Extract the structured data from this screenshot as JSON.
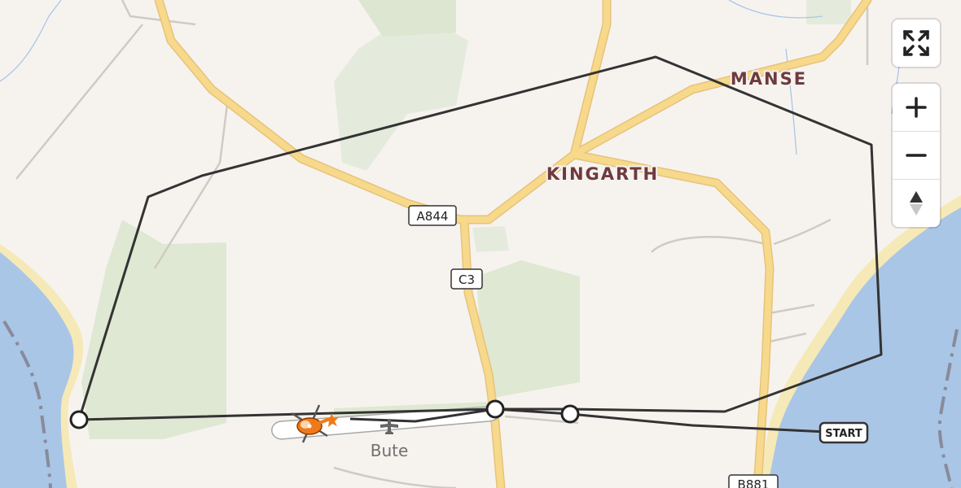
{
  "map": {
    "places": [
      {
        "name": "MANSE"
      },
      {
        "name": "KINGARTH"
      }
    ],
    "road_shields": [
      "A844",
      "C3",
      "B881"
    ],
    "airport": {
      "name": "Bute"
    },
    "route": {
      "start_label": "START"
    }
  },
  "controls": {
    "fullscreen_icon": "fullscreen-icon",
    "zoom_in_icon": "plus-icon",
    "zoom_out_icon": "minus-icon",
    "compass_icon": "compass-icon"
  },
  "colors": {
    "land": "#f6f3ef",
    "water": "#a9c6e6",
    "beach": "#f6e9b8",
    "park": "#dbe7cc",
    "road_major": "#f7d98c",
    "route_line": "#333333",
    "place_label": "#6e3a3e",
    "helicopter": "#f07a1a"
  }
}
